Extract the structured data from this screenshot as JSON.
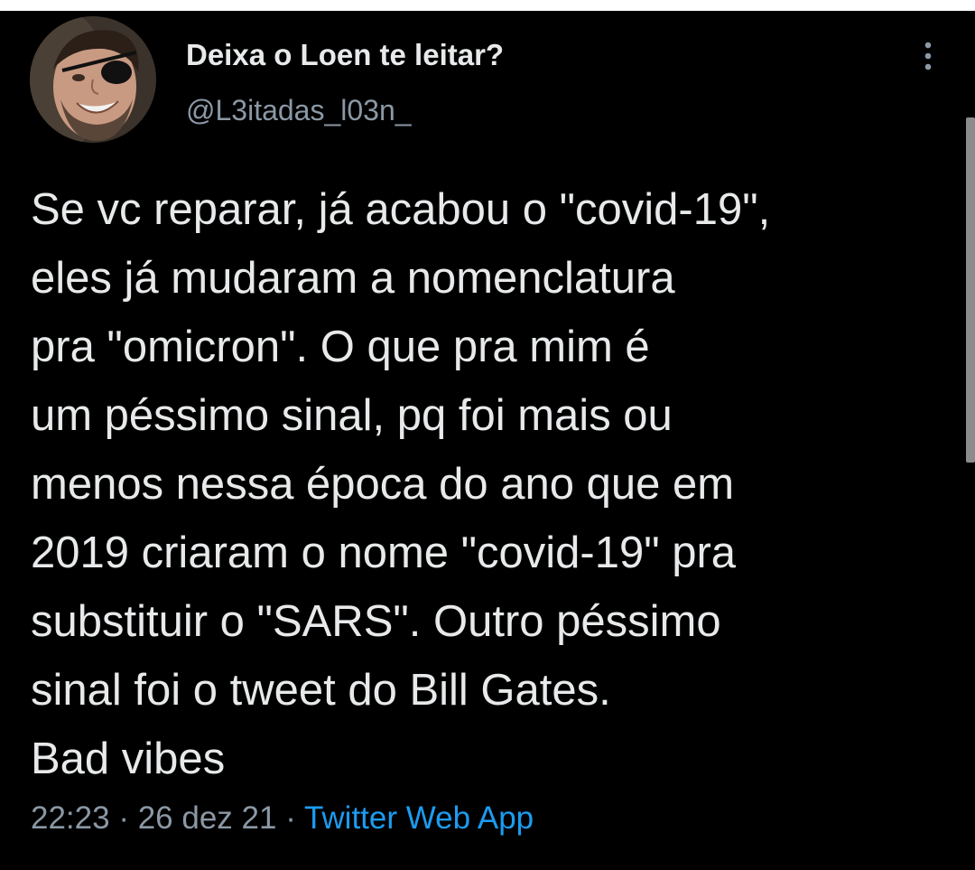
{
  "tweet": {
    "author": {
      "display_name": "Deixa o Loen te leitar?",
      "handle": "@L3itadas_l03n_"
    },
    "more_icon": "more-vertical-icon",
    "text_lines": [
      "Se vc reparar, já acabou o \"covid-19\",",
      "eles já mudaram a nomenclatura",
      "pra \"omicron\". O que pra mim é",
      "um péssimo sinal, pq foi mais ou",
      "menos nessa época do ano que em",
      "2019 criaram o nome \"covid-19\" pra",
      "substituir o \"SARS\". Outro péssimo",
      "sinal foi o tweet do Bill Gates.",
      "Bad vibes"
    ],
    "time": "22:23",
    "separator": "·",
    "date": "26 dez 21",
    "source": "Twitter Web App"
  },
  "colors": {
    "background": "#000000",
    "text": "#e7e9ea",
    "secondary_text": "#8b98a5",
    "link": "#1d9bf0"
  }
}
